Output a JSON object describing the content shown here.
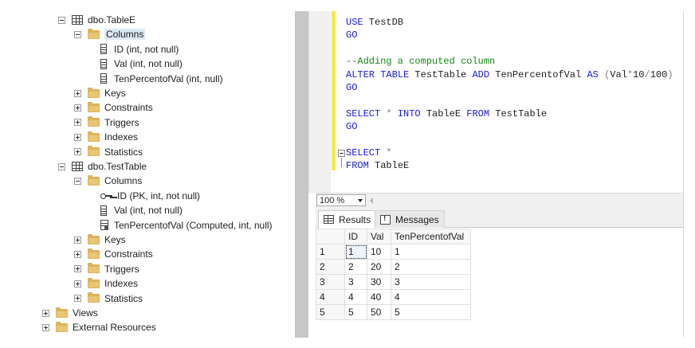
{
  "explorer": {
    "nodes": [
      {
        "label": "dbo.TableE",
        "icon": "table-icon",
        "expand": "minus"
      },
      {
        "label": "Columns",
        "icon": "folder-icon",
        "expand": "minus",
        "selected": true
      },
      {
        "label": "ID (int, not null)",
        "icon": "column-icon"
      },
      {
        "label": "Val (int, not null)",
        "icon": "column-icon"
      },
      {
        "label": "TenPercentofVal (int, null)",
        "icon": "column-icon"
      },
      {
        "label": "Keys",
        "icon": "folder-icon",
        "expand": "plus"
      },
      {
        "label": "Constraints",
        "icon": "folder-icon",
        "expand": "plus"
      },
      {
        "label": "Triggers",
        "icon": "folder-icon",
        "expand": "plus"
      },
      {
        "label": "Indexes",
        "icon": "folder-icon",
        "expand": "plus"
      },
      {
        "label": "Statistics",
        "icon": "folder-icon",
        "expand": "plus"
      },
      {
        "label": "dbo.TestTable",
        "icon": "table-icon",
        "expand": "minus"
      },
      {
        "label": "Columns",
        "icon": "folder-icon",
        "expand": "minus"
      },
      {
        "label": "ID (PK, int, not null)",
        "icon": "key-icon"
      },
      {
        "label": "Val (int, not null)",
        "icon": "column-icon"
      },
      {
        "label": "TenPercentofVal (Computed, int, null)",
        "icon": "computed-column-icon"
      },
      {
        "label": "Keys",
        "icon": "folder-icon",
        "expand": "plus"
      },
      {
        "label": "Constraints",
        "icon": "folder-icon",
        "expand": "plus"
      },
      {
        "label": "Triggers",
        "icon": "folder-icon",
        "expand": "plus"
      },
      {
        "label": "Indexes",
        "icon": "folder-icon",
        "expand": "plus"
      },
      {
        "label": "Statistics",
        "icon": "folder-icon",
        "expand": "plus"
      },
      {
        "label": "Views",
        "icon": "folder-icon",
        "expand": "plus"
      },
      {
        "label": "External Resources",
        "icon": "folder-icon",
        "expand": "plus"
      }
    ]
  },
  "editor": {
    "lines": [
      [
        {
          "t": "USE",
          "c": "kw"
        },
        {
          "t": " TestDB",
          "c": "tx"
        }
      ],
      [
        {
          "t": "GO",
          "c": "kw"
        }
      ],
      [],
      [
        {
          "t": "--Adding a computed column",
          "c": "cm"
        }
      ],
      [
        {
          "t": "ALTER",
          "c": "kw"
        },
        {
          "t": " ",
          "c": "tx"
        },
        {
          "t": "TABLE",
          "c": "kw"
        },
        {
          "t": " TestTable ",
          "c": "tx"
        },
        {
          "t": "ADD",
          "c": "kw"
        },
        {
          "t": " TenPercentofVal ",
          "c": "tx"
        },
        {
          "t": "AS",
          "c": "kw"
        },
        {
          "t": " ",
          "c": "tx"
        },
        {
          "t": "(",
          "c": "gr"
        },
        {
          "t": "Val",
          "c": "tx"
        },
        {
          "t": "*",
          "c": "gr"
        },
        {
          "t": "10",
          "c": "tx"
        },
        {
          "t": "/",
          "c": "gr"
        },
        {
          "t": "100",
          "c": "tx"
        },
        {
          "t": ")",
          "c": "gr"
        }
      ],
      [
        {
          "t": "GO",
          "c": "kw"
        }
      ],
      [],
      [
        {
          "t": "SELECT",
          "c": "kw"
        },
        {
          "t": " ",
          "c": "tx"
        },
        {
          "t": "*",
          "c": "gr"
        },
        {
          "t": " ",
          "c": "tx"
        },
        {
          "t": "INTO",
          "c": "kw"
        },
        {
          "t": " TableE ",
          "c": "tx"
        },
        {
          "t": "FROM",
          "c": "kw"
        },
        {
          "t": " TestTable",
          "c": "tx"
        }
      ],
      [
        {
          "t": "GO",
          "c": "kw"
        }
      ],
      [],
      [
        {
          "t": "SELECT",
          "c": "kw"
        },
        {
          "t": " ",
          "c": "tx"
        },
        {
          "t": "*",
          "c": "gr"
        }
      ],
      [
        {
          "t": "FROM",
          "c": "kw"
        },
        {
          "t": " TableE",
          "c": "tx"
        }
      ]
    ]
  },
  "zoom": {
    "value": "100 %"
  },
  "tabs": {
    "results": "Results",
    "messages": "Messages"
  },
  "grid": {
    "columns": [
      "ID",
      "Val",
      "TenPercentofVal"
    ],
    "rows": [
      {
        "num": "1",
        "cells": [
          "1",
          "10",
          "1"
        ]
      },
      {
        "num": "2",
        "cells": [
          "2",
          "20",
          "2"
        ]
      },
      {
        "num": "3",
        "cells": [
          "3",
          "30",
          "3"
        ]
      },
      {
        "num": "4",
        "cells": [
          "4",
          "40",
          "4"
        ]
      },
      {
        "num": "5",
        "cells": [
          "5",
          "50",
          "5"
        ]
      }
    ]
  },
  "colors": {
    "keyword": "#1a1ad6",
    "comment": "#178a17",
    "change_bar": "#f5e94b",
    "folder": "#dcb35c"
  }
}
